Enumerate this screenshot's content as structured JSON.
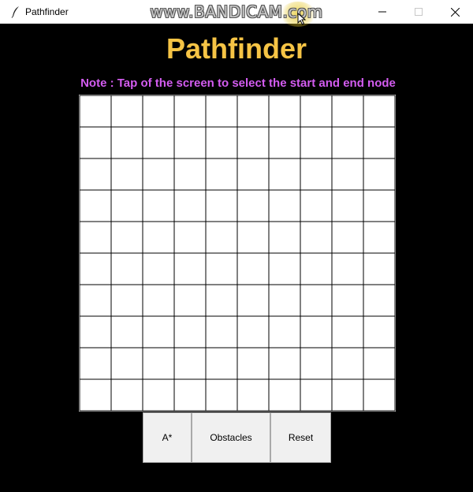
{
  "window": {
    "title": "Pathfinder",
    "watermark": "www.BANDICAM.com",
    "title_icon": "feather-icon",
    "controls": [
      "minimize-icon",
      "maximize-icon",
      "close-icon"
    ]
  },
  "app": {
    "title": "Pathfinder",
    "note": "Note : Tap of the screen to select the start and end node",
    "title_color": "#f6c445",
    "note_color": "#d35cf0",
    "background": "#000000"
  },
  "grid": {
    "rows": 10,
    "cols": 10,
    "cell_color": "#ffffff",
    "line_color": "#000000"
  },
  "buttons": {
    "astar": "A*",
    "obstacles": "Obstacles",
    "reset": "Reset"
  }
}
